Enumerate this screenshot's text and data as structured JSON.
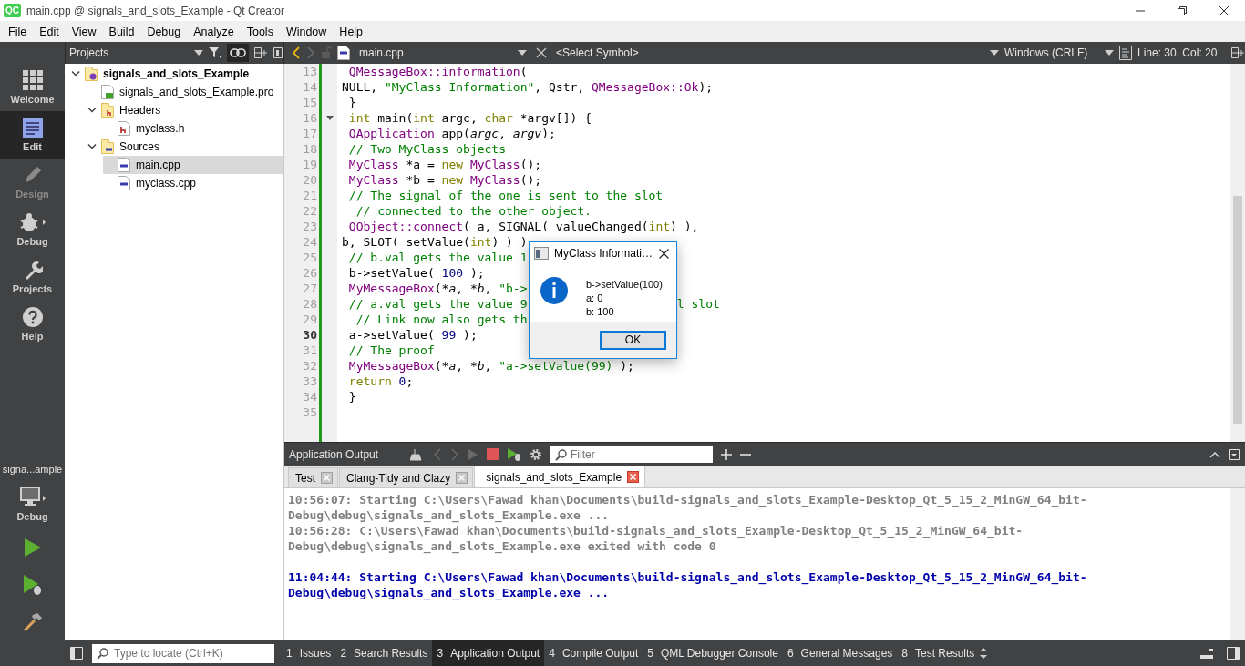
{
  "window": {
    "logo_text": "QC",
    "title": "main.cpp @ signals_and_slots_Example - Qt Creator"
  },
  "menu": [
    "File",
    "Edit",
    "View",
    "Build",
    "Debug",
    "Analyze",
    "Tools",
    "Window",
    "Help"
  ],
  "modes": [
    {
      "label": "Welcome",
      "selected": false,
      "disabled": false
    },
    {
      "label": "Edit",
      "selected": true,
      "disabled": false
    },
    {
      "label": "Design",
      "selected": false,
      "disabled": true
    },
    {
      "label": "Debug",
      "selected": false,
      "disabled": false
    },
    {
      "label": "Projects",
      "selected": false,
      "disabled": false
    },
    {
      "label": "Help",
      "selected": false,
      "disabled": false
    }
  ],
  "run_target": {
    "name": "signa...ample",
    "config": "Debug"
  },
  "projects_pane": {
    "title": "Projects"
  },
  "project_tree": [
    {
      "label": "signals_and_slots_Example",
      "kind": "project",
      "expanded": true,
      "selected": false,
      "children": [
        {
          "label": "signals_and_slots_Example.pro",
          "kind": "pro",
          "selected": false
        },
        {
          "label": "Headers",
          "kind": "header-folder",
          "expanded": true,
          "selected": false,
          "children": [
            {
              "label": "myclass.h",
              "kind": "header",
              "selected": false
            }
          ]
        },
        {
          "label": "Sources",
          "kind": "source-folder",
          "expanded": true,
          "selected": false,
          "children": [
            {
              "label": "main.cpp",
              "kind": "source",
              "selected": true
            },
            {
              "label": "myclass.cpp",
              "kind": "source",
              "selected": false
            }
          ]
        }
      ]
    }
  ],
  "editor_toolbar": {
    "file": "main.cpp",
    "symbol": "<Select Symbol>",
    "line_ending": "Windows (CRLF)",
    "position": "Line: 30, Col: 20"
  },
  "editor": {
    "lines": [
      {
        "number": "13",
        "current": false,
        "fold_marker": false,
        "tokens": [
          {
            "kind": "type",
            "text": " QMessageBox::information"
          },
          {
            "kind": "plain",
            "text": "("
          }
        ]
      },
      {
        "number": "14",
        "current": false,
        "fold_marker": false,
        "tokens": [
          {
            "kind": "plain",
            "text": "NULL, "
          },
          {
            "kind": "string",
            "text": "\"MyClass Information\""
          },
          {
            "kind": "plain",
            "text": ", Qstr, "
          },
          {
            "kind": "type",
            "text": "QMessageBox::Ok"
          },
          {
            "kind": "plain",
            "text": ");"
          }
        ]
      },
      {
        "number": "15",
        "current": false,
        "fold_marker": false,
        "tokens": [
          {
            "kind": "plain",
            "text": " }"
          }
        ]
      },
      {
        "number": "16",
        "current": false,
        "fold_marker": true,
        "tokens": [
          {
            "kind": "keyword",
            "text": " int"
          },
          {
            "kind": "plain",
            "text": " main("
          },
          {
            "kind": "keyword",
            "text": "int"
          },
          {
            "kind": "plain",
            "text": " argc, "
          },
          {
            "kind": "keyword",
            "text": "char"
          },
          {
            "kind": "plain",
            "text": " *argv[]) {"
          }
        ]
      },
      {
        "number": "17",
        "current": false,
        "fold_marker": false,
        "tokens": [
          {
            "kind": "type",
            "text": " QApplication"
          },
          {
            "kind": "plain",
            "text": " app("
          },
          {
            "kind": "param",
            "text": "argc"
          },
          {
            "kind": "plain",
            "text": ", "
          },
          {
            "kind": "param",
            "text": "argv"
          },
          {
            "kind": "plain",
            "text": ");"
          }
        ]
      },
      {
        "number": "18",
        "current": false,
        "fold_marker": false,
        "tokens": [
          {
            "kind": "comment",
            "text": " // Two MyClass objects"
          }
        ]
      },
      {
        "number": "19",
        "current": false,
        "fold_marker": false,
        "tokens": [
          {
            "kind": "type",
            "text": " MyClass"
          },
          {
            "kind": "plain",
            "text": " *a = "
          },
          {
            "kind": "keyword",
            "text": "new"
          },
          {
            "kind": "type",
            "text": " MyClass"
          },
          {
            "kind": "plain",
            "text": "();"
          }
        ]
      },
      {
        "number": "20",
        "current": false,
        "fold_marker": false,
        "tokens": [
          {
            "kind": "type",
            "text": " MyClass"
          },
          {
            "kind": "plain",
            "text": " *b = "
          },
          {
            "kind": "keyword",
            "text": "new"
          },
          {
            "kind": "type",
            "text": " MyClass"
          },
          {
            "kind": "plain",
            "text": "();"
          }
        ]
      },
      {
        "number": "21",
        "current": false,
        "fold_marker": false,
        "tokens": [
          {
            "kind": "comment",
            "text": " // The signal of the one is sent to the slot"
          }
        ]
      },
      {
        "number": "22",
        "current": false,
        "fold_marker": false,
        "tokens": [
          {
            "kind": "comment",
            "text": "  // connected to the other object."
          }
        ]
      },
      {
        "number": "23",
        "current": false,
        "fold_marker": false,
        "tokens": [
          {
            "kind": "type",
            "text": " QObject::connect"
          },
          {
            "kind": "plain",
            "text": "( a, SIGNAL( valueChanged("
          },
          {
            "kind": "keyword",
            "text": "int"
          },
          {
            "kind": "plain",
            "text": ") ),"
          }
        ]
      },
      {
        "number": "24",
        "current": false,
        "fold_marker": false,
        "tokens": [
          {
            "kind": "plain",
            "text": "b, SLOT( setValue("
          },
          {
            "kind": "keyword",
            "text": "int"
          },
          {
            "kind": "plain",
            "text": ") ) )"
          }
        ]
      },
      {
        "number": "25",
        "current": false,
        "fold_marker": false,
        "tokens": [
          {
            "kind": "comment",
            "text": " // b.val gets the value 1"
          }
        ]
      },
      {
        "number": "26",
        "current": false,
        "fold_marker": false,
        "tokens": [
          {
            "kind": "plain",
            "text": " b->setValue( "
          },
          {
            "kind": "number",
            "text": "100"
          },
          {
            "kind": "plain",
            "text": " );"
          }
        ]
      },
      {
        "number": "27",
        "current": false,
        "fold_marker": false,
        "tokens": [
          {
            "kind": "type",
            "text": " MyMessageBox"
          },
          {
            "kind": "plain",
            "text": "(*"
          },
          {
            "kind": "param",
            "text": "a"
          },
          {
            "kind": "plain",
            "text": ", *"
          },
          {
            "kind": "param",
            "text": "b"
          },
          {
            "kind": "plain",
            "text": ", "
          },
          {
            "kind": "string",
            "text": "\"b->"
          }
        ]
      },
      {
        "number": "28",
        "current": false,
        "fold_marker": false,
        "tokens": [
          {
            "kind": "comment",
            "text": " // a.val gets the value 9"
          }
        ],
        "tokens_after_dialog": [
          {
            "kind": "comment",
            "text": "l slot"
          }
        ]
      },
      {
        "number": "29",
        "current": false,
        "fold_marker": false,
        "tokens": [
          {
            "kind": "comment",
            "text": "  // Link now also gets th"
          }
        ]
      },
      {
        "number": "30",
        "current": true,
        "fold_marker": false,
        "tokens": [
          {
            "kind": "plain",
            "text": " a->setValue( "
          },
          {
            "kind": "number",
            "text": "99"
          },
          {
            "kind": "plain",
            "text": " );"
          }
        ]
      },
      {
        "number": "31",
        "current": false,
        "fold_marker": false,
        "tokens": [
          {
            "kind": "comment",
            "text": " // The proof"
          }
        ]
      },
      {
        "number": "32",
        "current": false,
        "fold_marker": false,
        "tokens": [
          {
            "kind": "type",
            "text": " MyMessageBox"
          },
          {
            "kind": "plain",
            "text": "(*"
          },
          {
            "kind": "param",
            "text": "a"
          },
          {
            "kind": "plain",
            "text": ", *"
          },
          {
            "kind": "param",
            "text": "b"
          },
          {
            "kind": "plain",
            "text": ", "
          },
          {
            "kind": "string",
            "text": "\"a->setValue(99)"
          },
          {
            "kind": "plain",
            "text": " );"
          }
        ]
      },
      {
        "number": "33",
        "current": false,
        "fold_marker": false,
        "tokens": [
          {
            "kind": "keyword",
            "text": " return"
          },
          {
            "kind": "number",
            "text": " 0"
          },
          {
            "kind": "plain",
            "text": ";"
          }
        ]
      },
      {
        "number": "34",
        "current": false,
        "fold_marker": false,
        "tokens": [
          {
            "kind": "plain",
            "text": " }"
          }
        ]
      },
      {
        "number": "35",
        "current": false,
        "fold_marker": false
      }
    ]
  },
  "dialog": {
    "title": "MyClass Informati…",
    "message_lines": [
      "b->setValue(100)",
      "a: 0",
      "b: 100"
    ],
    "button": "OK"
  },
  "output_pane": {
    "title": "Application Output",
    "filter_placeholder": "Filter",
    "tabs": [
      {
        "label": "Test",
        "selected": false
      },
      {
        "label": "Clang-Tidy and Clazy",
        "selected": false
      },
      {
        "label": "signals_and_slots_Example",
        "selected": true
      }
    ],
    "runs": [
      {
        "color": "#808080",
        "messages": [
          "10:56:07: Starting C:\\Users\\Fawad khan\\Documents\\build-signals_and_slots_Example-Desktop_Qt_5_15_2_MinGW_64_bit-Debug\\debug\\signals_and_slots_Example.exe ...",
          "10:56:28: C:\\Users\\Fawad khan\\Documents\\build-signals_and_slots_Example-Desktop_Qt_5_15_2_MinGW_64_bit-Debug\\debug\\signals_and_slots_Example.exe exited with code 0"
        ]
      },
      {
        "color": "#0000aa",
        "messages": [
          "11:04:44: Starting C:\\Users\\Fawad khan\\Documents\\build-signals_and_slots_Example-Desktop_Qt_5_15_2_MinGW_64_bit-Debug\\debug\\signals_and_slots_Example.exe ..."
        ]
      }
    ]
  },
  "status_bar": {
    "locator_placeholder": "Type to locate (Ctrl+K)",
    "tabs": [
      {
        "number": "1",
        "label": "Issues",
        "selected": false
      },
      {
        "number": "2",
        "label": "Search Results",
        "selected": false
      },
      {
        "number": "3",
        "label": "Application Output",
        "selected": true
      },
      {
        "number": "4",
        "label": "Compile Output",
        "selected": false
      },
      {
        "number": "5",
        "label": "QML Debugger Console",
        "selected": false
      },
      {
        "number": "6",
        "label": "General Messages",
        "selected": false
      },
      {
        "number": "8",
        "label": "Test Results",
        "selected": false
      }
    ]
  }
}
